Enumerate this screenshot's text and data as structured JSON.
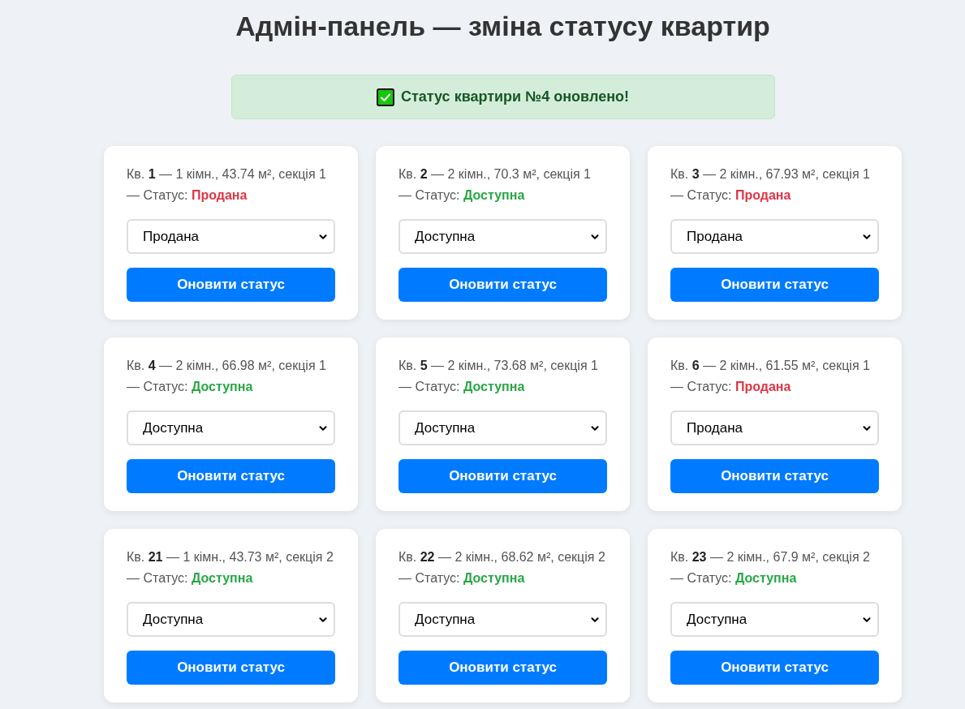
{
  "title": "Адмін-панель — зміна статусу квартир",
  "alert": {
    "kind": "success",
    "text": "Статус квартири №4 оновлено!"
  },
  "apartments": [
    {
      "description": "Кв. **1** — 1 кімн., 43.74 м², секція 1 — Статус:",
      "status": {
        "label": "Продана",
        "kind": "sold"
      },
      "select_value": "Продана",
      "button": "Оновити статус"
    },
    {
      "description": "Кв. **2** — 2 кімн., 70.3 м², секція 1 — Статус:",
      "status": {
        "label": "Доступна",
        "kind": "available"
      },
      "select_value": "Доступна",
      "button": "Оновити статус"
    },
    {
      "description": "Кв. **3** — 2 кімн., 67.93 м², секція 1 — Статус:",
      "status": {
        "label": "Продана",
        "kind": "sold"
      },
      "select_value": "Продана",
      "button": "Оновити статус"
    },
    {
      "description": "Кв. **4** — 2 кімн., 66.98 м², секція 1 — Статус:",
      "status": {
        "label": "Доступна",
        "kind": "available"
      },
      "select_value": "Доступна",
      "button": "Оновити статус"
    },
    {
      "description": "Кв. **5** — 2 кімн., 73.68 м², секція 1 — Статус:",
      "status": {
        "label": "Доступна",
        "kind": "available"
      },
      "select_value": "Доступна",
      "button": "Оновити статус"
    },
    {
      "description": "Кв. **6** — 2 кімн., 61.55 м², секція 1 — Статус:",
      "status": {
        "label": "Продана",
        "kind": "sold"
      },
      "select_value": "Продана",
      "button": "Оновити статус"
    },
    {
      "description": "Кв. **21** — 1 кімн., 43.73 м², секція 2 — Статус:",
      "status": {
        "label": "Доступна",
        "kind": "available"
      },
      "select_value": "Доступна",
      "button": "Оновити статус"
    },
    {
      "description": "Кв. **22** — 2 кімн., 68.62 м², секція 2 — Статус:",
      "status": {
        "label": "Доступна",
        "kind": "available"
      },
      "select_value": "Доступна",
      "button": "Оновити статус"
    },
    {
      "description": "Кв. **23** — 2 кімн., 67.9 м², секція 2 — Статус:",
      "status": {
        "label": "Доступна",
        "kind": "available"
      },
      "select_value": "Доступна",
      "button": "Оновити статус"
    }
  ]
}
